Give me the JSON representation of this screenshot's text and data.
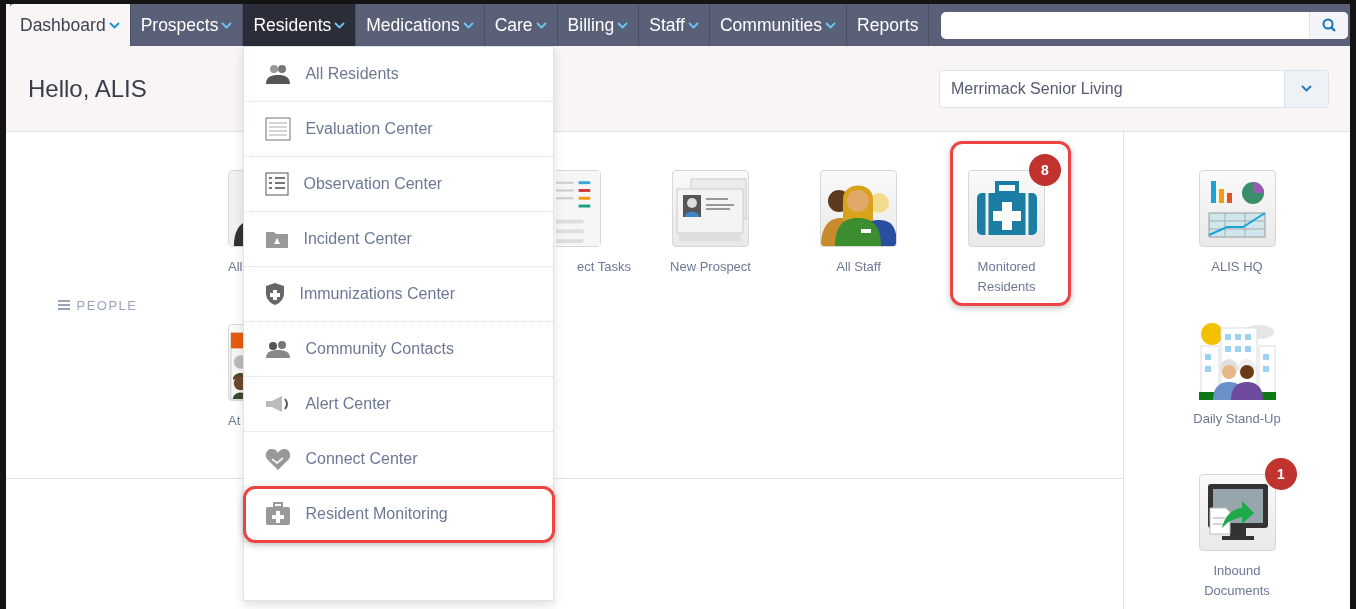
{
  "nav": {
    "items": [
      {
        "label": "Dashboard",
        "selected": true,
        "expanded": false,
        "has_menu": true
      },
      {
        "label": "Prospects",
        "selected": false,
        "expanded": false,
        "has_menu": true
      },
      {
        "label": "Residents",
        "selected": false,
        "expanded": true,
        "has_menu": true
      },
      {
        "label": "Medications",
        "selected": false,
        "expanded": false,
        "has_menu": true
      },
      {
        "label": "Care",
        "selected": false,
        "expanded": false,
        "has_menu": true
      },
      {
        "label": "Billing",
        "selected": false,
        "expanded": false,
        "has_menu": true
      },
      {
        "label": "Staff",
        "selected": false,
        "expanded": false,
        "has_menu": true
      },
      {
        "label": "Communities",
        "selected": false,
        "expanded": false,
        "has_menu": true
      },
      {
        "label": "Reports",
        "selected": false,
        "expanded": false,
        "has_menu": false
      }
    ]
  },
  "residents_menu": {
    "items": [
      {
        "label": "All Residents",
        "highlighted": false
      },
      {
        "label": "Evaluation Center",
        "highlighted": false
      },
      {
        "label": "Observation Center",
        "highlighted": false
      },
      {
        "label": "Incident Center",
        "highlighted": false
      },
      {
        "label": "Immunizations Center",
        "highlighted": false
      },
      {
        "label": "Community Contacts",
        "highlighted": false
      },
      {
        "label": "Alert Center",
        "highlighted": false
      },
      {
        "label": "Connect Center",
        "highlighted": false
      },
      {
        "label": "Resident Monitoring",
        "highlighted": true
      }
    ]
  },
  "header": {
    "greeting": "Hello, ALIS",
    "community": "Merrimack Senior Living"
  },
  "people": {
    "title": "PEOPLE",
    "rows": [
      [
        {
          "kind": "cut-right",
          "label": "All",
          "highlighted": false
        },
        {
          "kind": "cut-left",
          "label": "ect Tasks",
          "highlighted": false
        },
        {
          "kind": "full",
          "label": "New Prospect",
          "highlighted": false
        },
        {
          "kind": "full",
          "label": "All Staff",
          "highlighted": false
        },
        {
          "kind": "full",
          "label": "Monitored Residents",
          "badge": "8",
          "highlighted": true
        }
      ],
      [
        {
          "kind": "cut-right",
          "label": "At",
          "highlighted": false
        }
      ]
    ]
  },
  "sidebar": {
    "tiles": [
      {
        "label": "ALIS HQ"
      },
      {
        "label": "Daily Stand-Up"
      },
      {
        "label": "Inbound Documents",
        "badge": "1"
      }
    ]
  }
}
